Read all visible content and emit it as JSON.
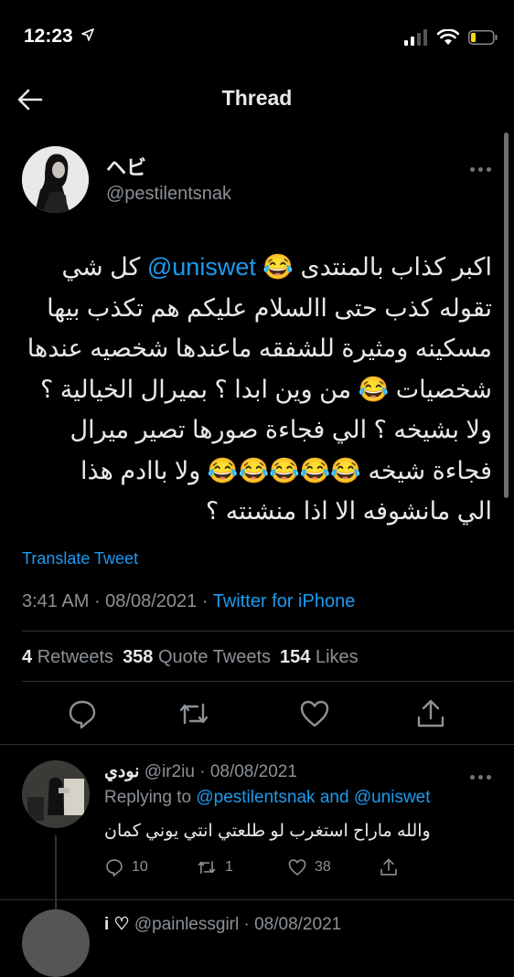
{
  "status": {
    "time": "12:23"
  },
  "header": {
    "title": "Thread"
  },
  "tweet": {
    "display_name": "ヘビ",
    "handle": "@pestilentsnak",
    "lines": [
      {
        "pre": "اكبر كذاب بالمنتدى 😂 ",
        "mention": "@uniswet",
        "post": " كل شي"
      },
      {
        "pre": "تقوله كذب حتى االسلام عليكم هم تكذب بيها"
      },
      {
        "pre": "مسكينه ومثيرة للشفقه ماعندها شخصيه عندها"
      },
      {
        "pre": "شخصيات 😂 من وين ابدا ؟ بميرال الخيالية ؟"
      },
      {
        "pre": "ولا بشيخه ؟ الي فجاءة صورها تصير ميرال"
      },
      {
        "pre": "فجاءة شيخه 😂😂😂😂😂 ولا باادم هذا"
      },
      {
        "pre": "الي مانشوفه الا اذا منشنته ؟"
      }
    ],
    "translate": "Translate Tweet",
    "time": "3:41 AM",
    "date": "08/08/2021",
    "source": "Twitter for iPhone",
    "retweets": "4",
    "retweets_label": "Retweets",
    "quotes": "358",
    "quotes_label": "Quote Tweets",
    "likes": "154",
    "likes_label": "Likes"
  },
  "reply": {
    "name": "نودي",
    "handle": "@ir2iu",
    "date": "08/08/2021",
    "replying_prefix": "Replying to",
    "replying_to_1": "@pestilentsnak",
    "and": "and",
    "replying_to_2": "@uniswet",
    "text": "والله ماراح استغرب لو طلعتي انتي يوني كمان",
    "replies": "10",
    "retweets": "1",
    "likes": "38"
  },
  "next_reply": {
    "name": "i ♡",
    "handle": "@painlessgirl",
    "date": "08/08/2021"
  },
  "colors": {
    "accent": "#1d9bf0",
    "background": "#000000",
    "muted": "#8b9196"
  }
}
